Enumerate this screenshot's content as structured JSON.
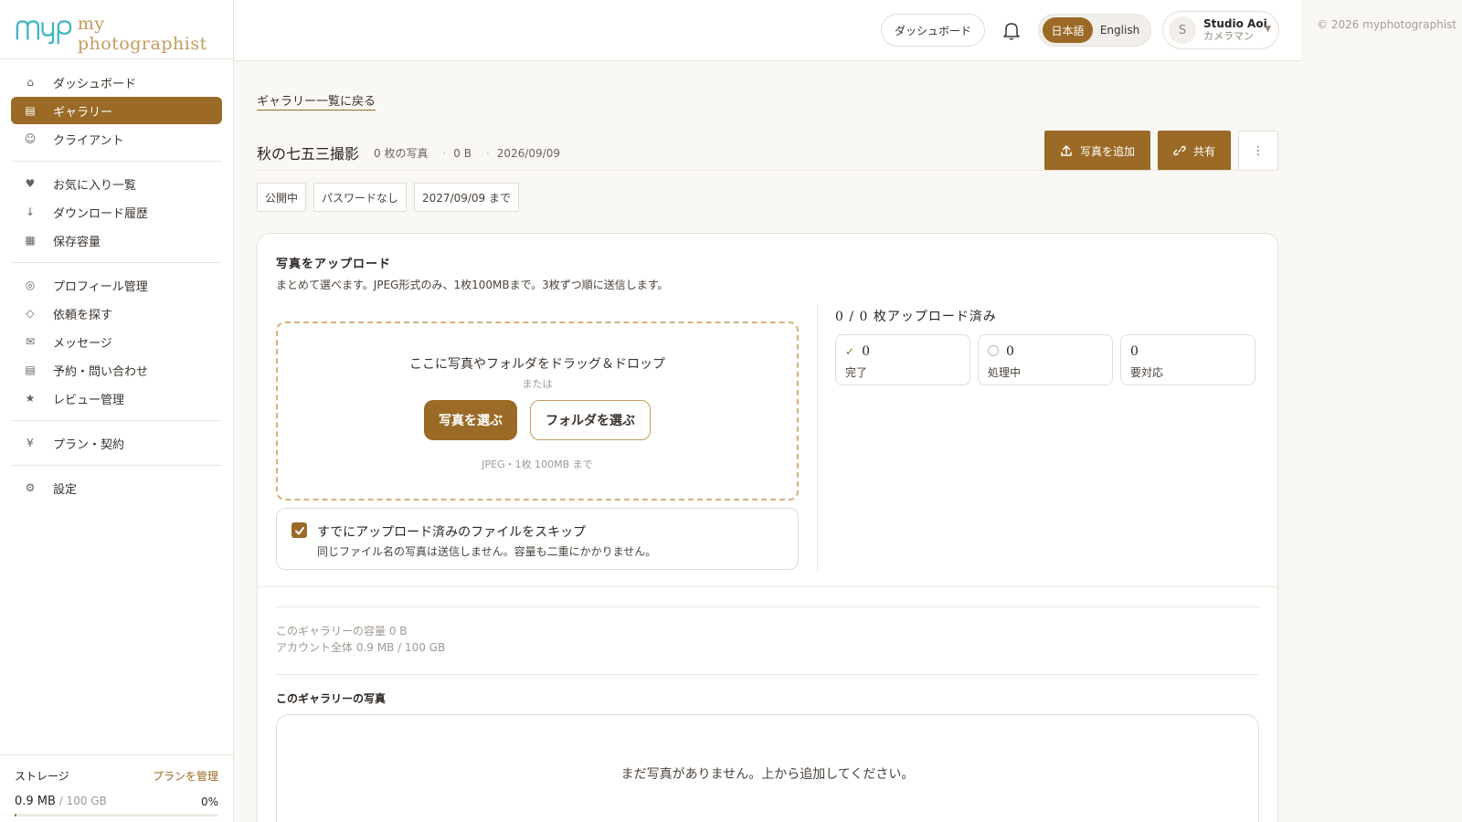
{
  "brand": {
    "mark": "myp",
    "name": "my photographist"
  },
  "sidebar": {
    "items": [
      {
        "label": "ダッシュボード",
        "icon": "home-icon",
        "glyph": "⌂",
        "active": false
      },
      {
        "label": "ギャラリー",
        "icon": "gallery-icon",
        "glyph": "▤",
        "active": true
      },
      {
        "label": "クライアント",
        "icon": "client-icon",
        "glyph": "☺",
        "active": false
      },
      {
        "label": "お気に入り一覧",
        "icon": "heart-icon",
        "glyph": "♥",
        "active": false
      },
      {
        "label": "ダウンロード履歴",
        "icon": "download-icon",
        "glyph": "↓",
        "active": false
      },
      {
        "label": "保存容量",
        "icon": "storage-icon",
        "glyph": "▦",
        "active": false
      },
      {
        "label": "プロフィール管理",
        "icon": "profile-icon",
        "glyph": "◎",
        "active": false
      },
      {
        "label": "依頼を探す",
        "icon": "diamond-icon",
        "glyph": "◇",
        "active": false
      },
      {
        "label": "メッセージ",
        "icon": "mail-icon",
        "glyph": "✉",
        "active": false
      },
      {
        "label": "予約・問い合わせ",
        "icon": "calendar-icon",
        "glyph": "▤",
        "active": false
      },
      {
        "label": "レビュー管理",
        "icon": "star-icon",
        "glyph": "★",
        "active": false
      },
      {
        "label": "プラン・契約",
        "icon": "yen-icon",
        "glyph": "¥",
        "active": false
      },
      {
        "label": "設定",
        "icon": "gear-icon",
        "glyph": "⚙",
        "active": false
      }
    ],
    "storage": {
      "label": "ストレージ",
      "plan_link": "プランを管理",
      "used": "0.9 MB",
      "total": " / 100 GB",
      "percent": "0%",
      "fraction": 0.009
    }
  },
  "topbar": {
    "dashboard_label": "ダッシュボード",
    "lang_active": "日本語",
    "lang_other": "English",
    "user_initial": "S",
    "user_name": "Studio Aoi",
    "user_role": "カメラマン"
  },
  "copyright": "© 2026 myphotographist",
  "gallery": {
    "back_link": "ギャラリー一覧に戻る",
    "title": "秋の七五三撮影",
    "photo_count": "0 枚の写真",
    "size": "0 B",
    "date": "2026/09/09",
    "add_button": "写真を追加",
    "share_button": "共有",
    "more_glyph": "⋮",
    "badges": [
      "公開中",
      "パスワードなし",
      "2027/09/09 まで"
    ]
  },
  "upload": {
    "title": "写真をアップロード",
    "description": "まとめて選べます。JPEG形式のみ、1枚100MBまで。3枚ずつ順に送信します。",
    "drop_text": "ここに写真やフォルダをドラッグ＆ドロップ",
    "or_text": "または",
    "choose_photos": "写真を選ぶ",
    "choose_folder": "フォルダを選ぶ",
    "hint": "JPEG・1枚 100MB まで",
    "skip_label": "すでにアップロード済みのファイルをスキップ",
    "skip_sub": "同じファイル名の写真は送信しません。容量も二重にかかりません。",
    "skip_checked": true,
    "progress_title": "0 / 0 枚アップロード済み",
    "stats": [
      {
        "value": "0",
        "label": "完了",
        "marker": "✓"
      },
      {
        "value": "0",
        "label": "処理中",
        "marker": "ring"
      },
      {
        "value": "0",
        "label": "要対応",
        "marker": ""
      }
    ]
  },
  "capacity": {
    "gallery": "このギャラリーの容量 0 B",
    "account": "アカウント全体 0.9 MB / 100 GB"
  },
  "photos": {
    "title": "このギャラリーの写真",
    "empty": "まだ写真がありません。上から追加してください。"
  },
  "colors": {
    "accent": "#9a6a26",
    "logo": "#3db5c4"
  }
}
